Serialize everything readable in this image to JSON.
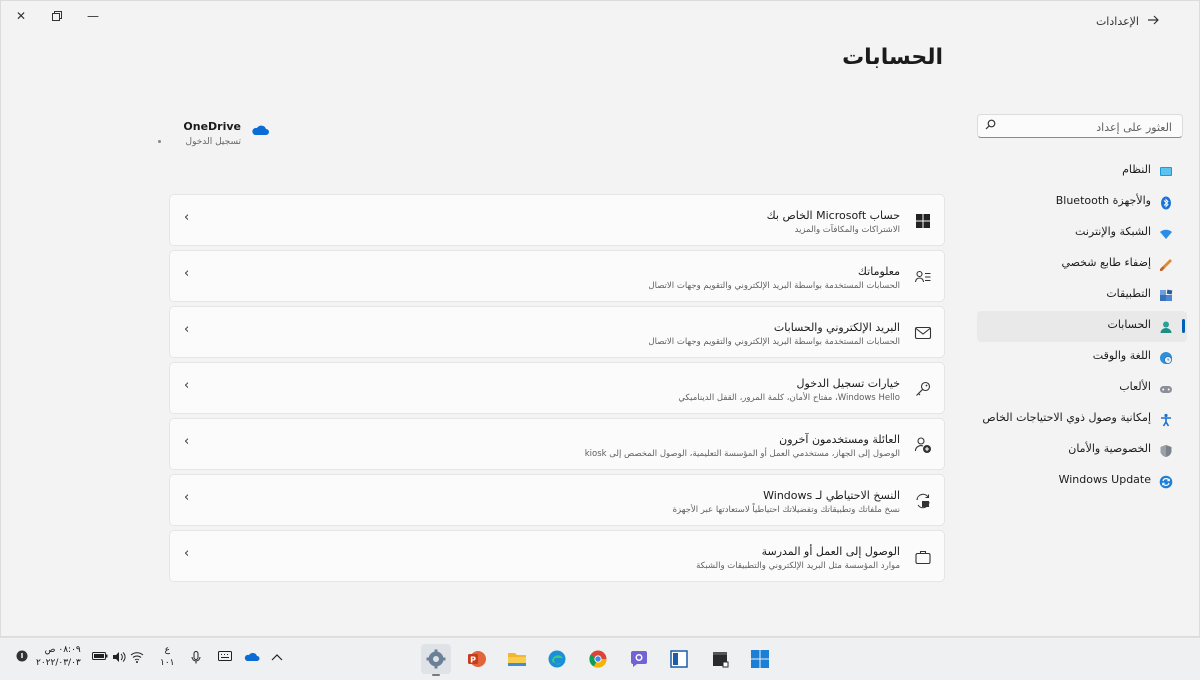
{
  "window": {
    "app_title": "الإعدادات",
    "page_title": "الحسابات"
  },
  "onedrive": {
    "name": "OneDrive",
    "status": "تسجيل الدخول"
  },
  "search": {
    "placeholder": "العثور على إعداد"
  },
  "nav": {
    "items": [
      {
        "label": "النظام",
        "icon": "display-icon"
      },
      {
        "label": "Bluetooth والأجهزة",
        "icon": "bluetooth-icon"
      },
      {
        "label": "الشبكة والإنترنت",
        "icon": "wifi-icon"
      },
      {
        "label": "إضفاء طابع شخصي",
        "icon": "brush-icon"
      },
      {
        "label": "التطبيقات",
        "icon": "apps-icon"
      },
      {
        "label": "الحسابات",
        "icon": "person-icon",
        "active": true
      },
      {
        "label": "اللغة والوقت",
        "icon": "globe-clock-icon"
      },
      {
        "label": "الألعاب",
        "icon": "gamepad-icon"
      },
      {
        "label": "إمكانية وصول ذوي الاحتياجات الخاص",
        "icon": "accessibility-icon"
      },
      {
        "label": "الخصوصية والأمان",
        "icon": "shield-icon"
      },
      {
        "label": "Windows Update",
        "icon": "update-icon"
      }
    ]
  },
  "cards": [
    {
      "title": "حساب Microsoft الخاص بك",
      "subtitle": "الاشتراكات والمكافآت والمزيد",
      "icon": "windows-logo-icon"
    },
    {
      "title": "معلوماتك",
      "subtitle": "الحسابات المستخدمة بواسطة البريد الإلكتروني والتقويم وجهات الاتصال",
      "icon": "person-info-icon"
    },
    {
      "title": "البريد الإلكتروني والحسابات",
      "subtitle": "الحسابات المستخدمة بواسطة البريد الإلكتروني والتقويم وجهات الاتصال",
      "icon": "mail-icon"
    },
    {
      "title": "خيارات تسجيل الدخول",
      "subtitle": "Windows Hello، مفتاح الأمان، كلمة المرور، القفل الديناميكي",
      "icon": "key-icon"
    },
    {
      "title": "العائلة ومستخدمون آخرون",
      "subtitle": "الوصول إلى الجهاز، مستخدمي العمل أو المؤسسة التعليمية، الوصول المخصص إلى kiosk",
      "icon": "person-add-icon"
    },
    {
      "title": "النسخ الاحتياطي لـ Windows",
      "subtitle": "نسخ ملفاتك وتطبيقاتك وتفضيلاتك احتياطياً لاستعادتها عبر الأجهزة",
      "icon": "backup-icon"
    },
    {
      "title": "الوصول إلى العمل أو المدرسة",
      "subtitle": "موارد المؤسسة مثل البريد الإلكتروني والتطبيقات والشبكة",
      "icon": "briefcase-icon"
    }
  ],
  "taskbar": {
    "time": "٠٨:٠٩ ص",
    "date": "٢٠٢٢/٠٣/٠٣",
    "lang_top": "ع",
    "lang_bottom": "١٠١"
  },
  "colors": {
    "accent": "#005fb8",
    "background": "#f3f3f3",
    "card": "#fbfbfb"
  }
}
